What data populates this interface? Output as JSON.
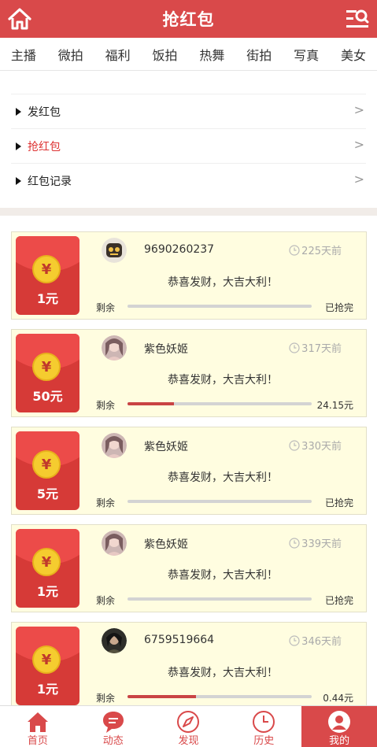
{
  "header": {
    "title": "抢红包",
    "home_icon": "home-icon",
    "menu_icon": "list-search-icon"
  },
  "tabs": [
    "主播",
    "微拍",
    "福利",
    "饭拍",
    "热舞",
    "街拍",
    "写真",
    "美女"
  ],
  "menu": [
    {
      "label": "发红包",
      "arrow": ">",
      "active": false
    },
    {
      "label": "抢红包",
      "arrow": ">",
      "active": true
    },
    {
      "label": "红包记录",
      "arrow": ">",
      "active": false
    }
  ],
  "packets": [
    {
      "amount": "1元",
      "coin": "¥",
      "user": "9690260237",
      "time": "225天前",
      "message": "恭喜发财，大吉大利！",
      "remain_label": "剩余",
      "progress": 0,
      "status": "已抢完"
    },
    {
      "amount": "50元",
      "coin": "¥",
      "user": "紫色妖姬",
      "time": "317天前",
      "message": "恭喜发财，大吉大利！",
      "remain_label": "剩余",
      "progress": 0.25,
      "status": "24.15元"
    },
    {
      "amount": "5元",
      "coin": "¥",
      "user": "紫色妖姬",
      "time": "330天前",
      "message": "恭喜发财，大吉大利！",
      "remain_label": "剩余",
      "progress": 0,
      "status": "已抢完"
    },
    {
      "amount": "1元",
      "coin": "¥",
      "user": "紫色妖姬",
      "time": "339天前",
      "message": "恭喜发财，大吉大利！",
      "remain_label": "剩余",
      "progress": 0,
      "status": "已抢完"
    },
    {
      "amount": "1元",
      "coin": "¥",
      "user": "6759519664",
      "time": "346天前",
      "message": "恭喜发财，大吉大利！",
      "remain_label": "剩余",
      "progress": 0.37,
      "status": "0.44元"
    }
  ],
  "bottom_nav": [
    {
      "label": "首页",
      "icon": "home-icon",
      "active": false
    },
    {
      "label": "动态",
      "icon": "chat-bubble-icon",
      "active": false
    },
    {
      "label": "发现",
      "icon": "compass-icon",
      "active": false
    },
    {
      "label": "历史",
      "icon": "clock-icon",
      "active": false
    },
    {
      "label": "我的",
      "icon": "user-icon",
      "active": true
    }
  ],
  "colors": {
    "primary": "#d9494a",
    "card_bg": "#fffde0",
    "envelope": "#d63a37",
    "coin": "#f5cc2f"
  }
}
